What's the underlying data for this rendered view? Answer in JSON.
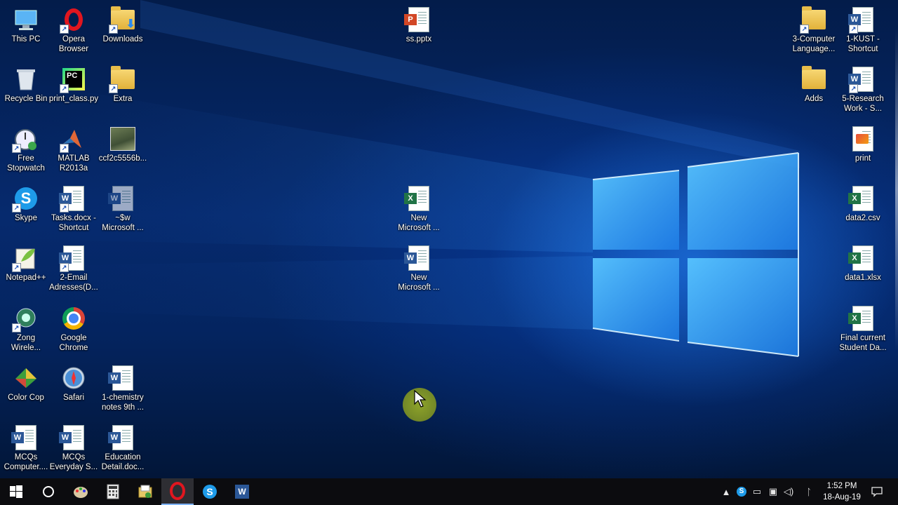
{
  "desktop_icons": {
    "this_pc": "This PC",
    "opera": "Opera\nBrowser",
    "downloads": "Downloads",
    "ss_pptx": "ss.pptx",
    "computer_language": "3-Computer\nLanguage...",
    "kust": "1-KUST -\nShortcut",
    "recycle_bin": "Recycle Bin",
    "print_class": "print_class.py",
    "extra": "Extra",
    "adds": "Adds",
    "research_work": "5-Research\nWork - S...",
    "free_stopwatch": "Free\nStopwatch",
    "matlab": "MATLAB\nR2013a",
    "ccf_image": "ccf2c5556b...",
    "print": "print",
    "skype": "Skype",
    "tasks_docx": "Tasks.docx -\nShortcut",
    "tmp_word": "~$w\nMicrosoft ...",
    "new_excel": "New\nMicrosoft ...",
    "data2_csv": "data2.csv",
    "notepadpp": "Notepad++",
    "email_addresses": "2-Email\nAdresses(D...",
    "new_word": "New\nMicrosoft ...",
    "data1_xlsx": "data1.xlsx",
    "zong": "Zong\nWirele...",
    "google_chrome": "Google\nChrome",
    "final_current": "Final current\nStudent Da...",
    "color_cop": "Color Cop",
    "safari": "Safari",
    "chemistry_notes": "1-chemistry\nnotes 9th ...",
    "mcqs_computer": "MCQs\nComputer....",
    "mcqs_everyday": "MCQs\nEveryday S...",
    "education_detail": "Education\nDetail.doc..."
  },
  "taskbar": {
    "clock_time": "1:52 PM",
    "clock_date": "18-Aug-19"
  },
  "colors": {
    "taskbar_bg": "#0c0c0f",
    "active_indicator": "#7fb4ff",
    "word_blue": "#2b5797",
    "excel_green": "#217346",
    "ppt_orange": "#d24726"
  }
}
